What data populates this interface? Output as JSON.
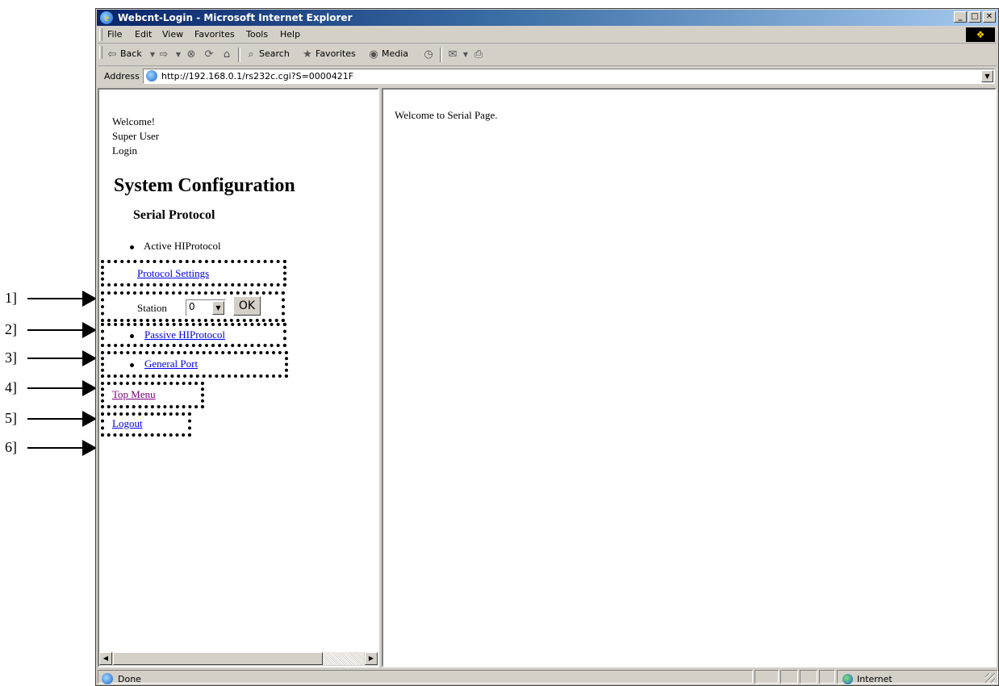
{
  "annotations": [
    "1]",
    "2]",
    "3]",
    "4]",
    "5]",
    "6]"
  ],
  "window": {
    "title": "Webcnt-Login - Microsoft Internet Explorer",
    "controls": {
      "minimize": "_",
      "maximize": "□",
      "close": "✕"
    }
  },
  "menubar": [
    "File",
    "Edit",
    "View",
    "Favorites",
    "Tools",
    "Help"
  ],
  "toolbar": {
    "back": "Back",
    "search": "Search",
    "favorites": "Favorites",
    "media": "Media",
    "icons": [
      "back-arrow-icon",
      "forward-arrow-icon",
      "stop-icon",
      "refresh-icon",
      "home-icon",
      "search-icon",
      "favorites-icon",
      "media-icon",
      "history-icon",
      "mail-icon",
      "print-icon"
    ]
  },
  "address": {
    "label": "Address",
    "url": "http://192.168.0.1/rs232c.cgi?S=0000421F"
  },
  "left_frame": {
    "welcome": "Welcome!",
    "user": "Super User",
    "login": "Login",
    "system_title": "System Configuration",
    "serial_title": "Serial Protocol",
    "active_protocol": "Active HIProtocol",
    "protocol_settings": "Protocol Settings",
    "station_label": "Station",
    "station_value": "0",
    "ok_label": "OK",
    "passive_protocol": "Passive HIProtocol",
    "general_port": "General Port",
    "top_menu": "Top Menu",
    "logout": "Logout"
  },
  "right_frame": {
    "message": "Welcome to Serial Page."
  },
  "statusbar": {
    "status": "Done",
    "zone": "Internet"
  },
  "colors": {
    "link": "#0000ee",
    "visited_link": "#800080",
    "titlebar_start": "#0a246a",
    "titlebar_end": "#a6caf0",
    "chrome": "#d4d0c8"
  }
}
